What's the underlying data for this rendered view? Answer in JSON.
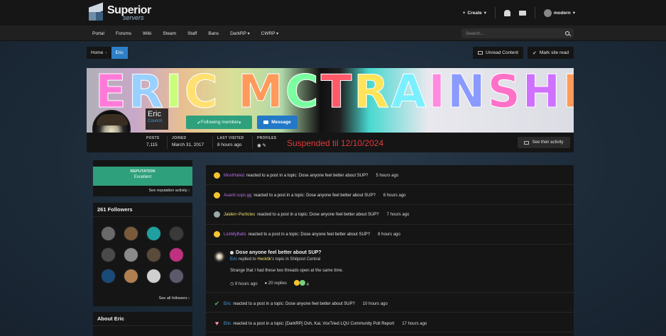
{
  "header": {
    "logo_word": "Superior",
    "logo_sub": "servers",
    "create_label": "Create",
    "style_label": "modern"
  },
  "nav": {
    "items": [
      "Portal",
      "Forums",
      "Wiki",
      "Steam",
      "Staff",
      "Bans",
      "DarkRP",
      "CWRP"
    ],
    "search_placeholder": "Search..."
  },
  "breadcrumb": {
    "home": "Home",
    "current": "Eric",
    "unread_label": "Unread Content",
    "mark_read_label": "Mark site read"
  },
  "profile": {
    "banner_text": "ERIC MCTRAINSHIT",
    "name": "Eric",
    "title": "Council",
    "following_label": "Following member",
    "message_label": "Message",
    "stats": [
      {
        "label": "POSTS",
        "value": "7,115"
      },
      {
        "label": "JOINED",
        "value": "March 31, 2017"
      },
      {
        "label": "LAST VISITED",
        "value": "8 hours ago"
      },
      {
        "label": "PROFILES",
        "value": ""
      }
    ],
    "suspended_text": "Suspended til 12/10/2024",
    "see_activity_label": "See their activity"
  },
  "sidebar": {
    "reputation_label": "REPUTATION",
    "reputation_value": "Excellent",
    "reputation_link": "See reputation activity",
    "followers_title": "261 Followers",
    "see_all_followers": "See all followers",
    "about_title": "About Eric",
    "follower_colors": [
      "#6a6a6a",
      "#7a5a3a",
      "#20a0a0",
      "#3a3a3a",
      "#4a4a4a",
      "#8a8a8a",
      "#5a4a3a",
      "#c03080",
      "#1a4a7a",
      "#b08050",
      "#cfcfcf",
      "#5a5a6a"
    ]
  },
  "feed": {
    "items": [
      {
        "user": "MostHated",
        "text": "reacted to a post in a topic: Dose anyone feel better about SUP?",
        "time": "5 hours ago"
      },
      {
        "user": "Asanti sups.gg",
        "text": "reacted to a post in a topic: Dose anyone feel better about SUP?",
        "time": "6 hours ago"
      },
      {
        "user": "Jaiden~Particles",
        "text": "reacted to a post in a topic: Dose anyone feel better about SUP?",
        "time": "7 hours ago"
      },
      {
        "user": "LickMyBalls",
        "text": "reacted to a post in a topic: Dose anyone feel better about SUP?",
        "time": "8 hours ago"
      }
    ],
    "post": {
      "title": "Dose anyone feel better about SUP?",
      "author": "Eric",
      "replied_to": "replied to",
      "target_user": "Hecktik",
      "target_suffix": "'s topic in Shitpost Central",
      "body": "Strange that I had these two threads open at the same time.",
      "time": "9 hours ago",
      "replies": "20 replies",
      "reactions": "4"
    },
    "items2": [
      {
        "user": "Eric",
        "text": "reacted to a post in a topic: Dose anyone feel better about SUP?",
        "time": "10 hours ago"
      },
      {
        "user": "Eric",
        "text": "reacted to a post in a topic: [DarkRP] Osh, Kai, VoxTried LQU Community Poll Report",
        "time": "17 hours ago"
      }
    ]
  }
}
